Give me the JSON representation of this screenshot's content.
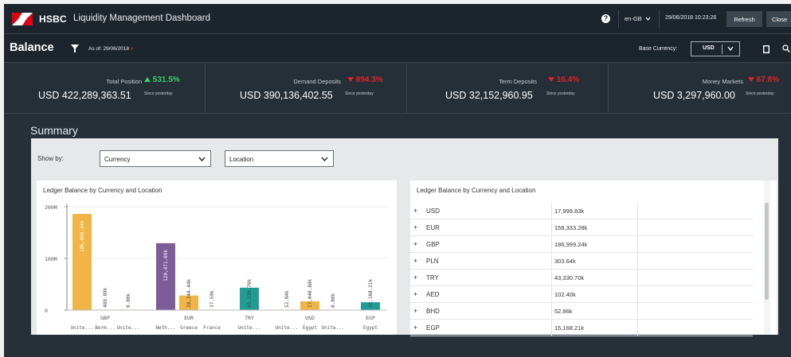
{
  "header": {
    "brand": "HSBC",
    "app_title": "Liquidity Management Dashboard",
    "help_icon": "?",
    "locale": "en-GB",
    "datetime": "29/06/2018 10:23:26",
    "refresh_label": "Refresh",
    "close_label": "Close",
    "logo_color": "#db0011"
  },
  "balance_bar": {
    "title": "Balance",
    "as_of_label": "As of:",
    "as_of_date": "29/06/2018",
    "clear_symbol": "×",
    "base_currency_label": "Base Currency:",
    "base_currency_value": "USD"
  },
  "metrics": [
    {
      "label": "Total Position",
      "pct": "531.5%",
      "direction": "up",
      "value": "USD 422,289,363.51",
      "since": "Since yesterday"
    },
    {
      "label": "Demand Deposits",
      "pct": "894.3%",
      "direction": "down",
      "value": "USD 390,136,402.55",
      "since": "Since yesterday"
    },
    {
      "label": "Term Deposits",
      "pct": "16.4%",
      "direction": "down",
      "value": "USD 32,152,960.95",
      "since": "Since yesterday"
    },
    {
      "label": "Money Markets",
      "pct": "67.8%",
      "direction": "down",
      "value": "USD 3,297,960.00",
      "since": "Since yesterday"
    }
  ],
  "summary": {
    "title": "Summary",
    "show_by_label": "Show by:",
    "select1": "Currency",
    "select2": "Location"
  },
  "chart_data": {
    "type": "bar",
    "title": "Ledger Balance by Currency and Location",
    "ylim": [
      0,
      200000000
    ],
    "yticks": [
      {
        "value": 0,
        "label": "0"
      },
      {
        "value": 100000000,
        "label": "100M"
      },
      {
        "value": 200000000,
        "label": "200M"
      }
    ],
    "groups": [
      {
        "name": "GBP",
        "bars": [
          {
            "location": "Unite...",
            "value": 186088340,
            "label": "186,088.34k",
            "color": "#f0b546"
          },
          {
            "location": "Berm...",
            "value": 489890,
            "label": "489.89k",
            "color": "#f0b546"
          },
          {
            "location": "Unite...",
            "value": 0,
            "label": "0.00k",
            "color": "#f0b546"
          }
        ]
      },
      {
        "name": "EUR",
        "bars": [
          {
            "location": "Neth...",
            "value": 129471090,
            "label": "129,471.09k",
            "color": "#7d5c97"
          },
          {
            "location": "Greece",
            "value": 28244440,
            "label": "28,244.44k",
            "color": "#f0b546"
          },
          {
            "location": "France",
            "value": 37590,
            "label": "37.59k",
            "color": "#f0b546"
          }
        ]
      },
      {
        "name": "TRY",
        "bars": [
          {
            "location": "Unite...",
            "value": 43330700,
            "label": "43,330.70k",
            "color": "#1f9c94"
          }
        ]
      },
      {
        "name": "USD",
        "bars": [
          {
            "location": "Unite...",
            "value": 52840,
            "label": "52.84k",
            "color": "#f0b546"
          },
          {
            "location": "Egypt",
            "value": 17040880,
            "label": "17,040.88k",
            "color": "#f0b546"
          },
          {
            "location": "Unite...",
            "value": 0,
            "label": "0.00k",
            "color": "#f0b546"
          }
        ]
      },
      {
        "name": "EGP",
        "bars": [
          {
            "location": "Egypt",
            "value": 15168210,
            "label": "15,168.21k",
            "color": "#1f9c94"
          }
        ]
      }
    ]
  },
  "table": {
    "title": "Ledger Balance by Currency and Location",
    "rows": [
      {
        "code": "USD",
        "value": "17,999.83k"
      },
      {
        "code": "EUR",
        "value": "158,333.28k"
      },
      {
        "code": "GBP",
        "value": "186,999.24k"
      },
      {
        "code": "PLN",
        "value": "303.64k"
      },
      {
        "code": "TRY",
        "value": "43,330.70k"
      },
      {
        "code": "AED",
        "value": "102.40k"
      },
      {
        "code": "BHD",
        "value": "52.86k"
      },
      {
        "code": "EGP",
        "value": "15,168.21k"
      }
    ]
  }
}
